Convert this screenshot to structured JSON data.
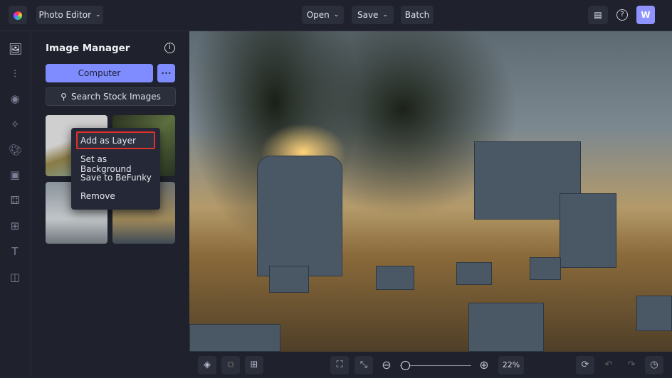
{
  "topbar": {
    "app_menu": "Photo Editor",
    "open": "Open",
    "save": "Save",
    "batch": "Batch",
    "avatar": "W"
  },
  "panel": {
    "title": "Image Manager",
    "computer": "Computer",
    "more": "•••",
    "search": "Search Stock Images"
  },
  "context_menu": {
    "items": [
      "Add as Layer",
      "Set as Background",
      "Save to BeFunky",
      "Remove"
    ],
    "highlight_color": "#e0322a"
  },
  "bottombar": {
    "zoom": "22%",
    "zoom_fraction": 0.05
  },
  "colors": {
    "accent": "#7e8cff"
  }
}
